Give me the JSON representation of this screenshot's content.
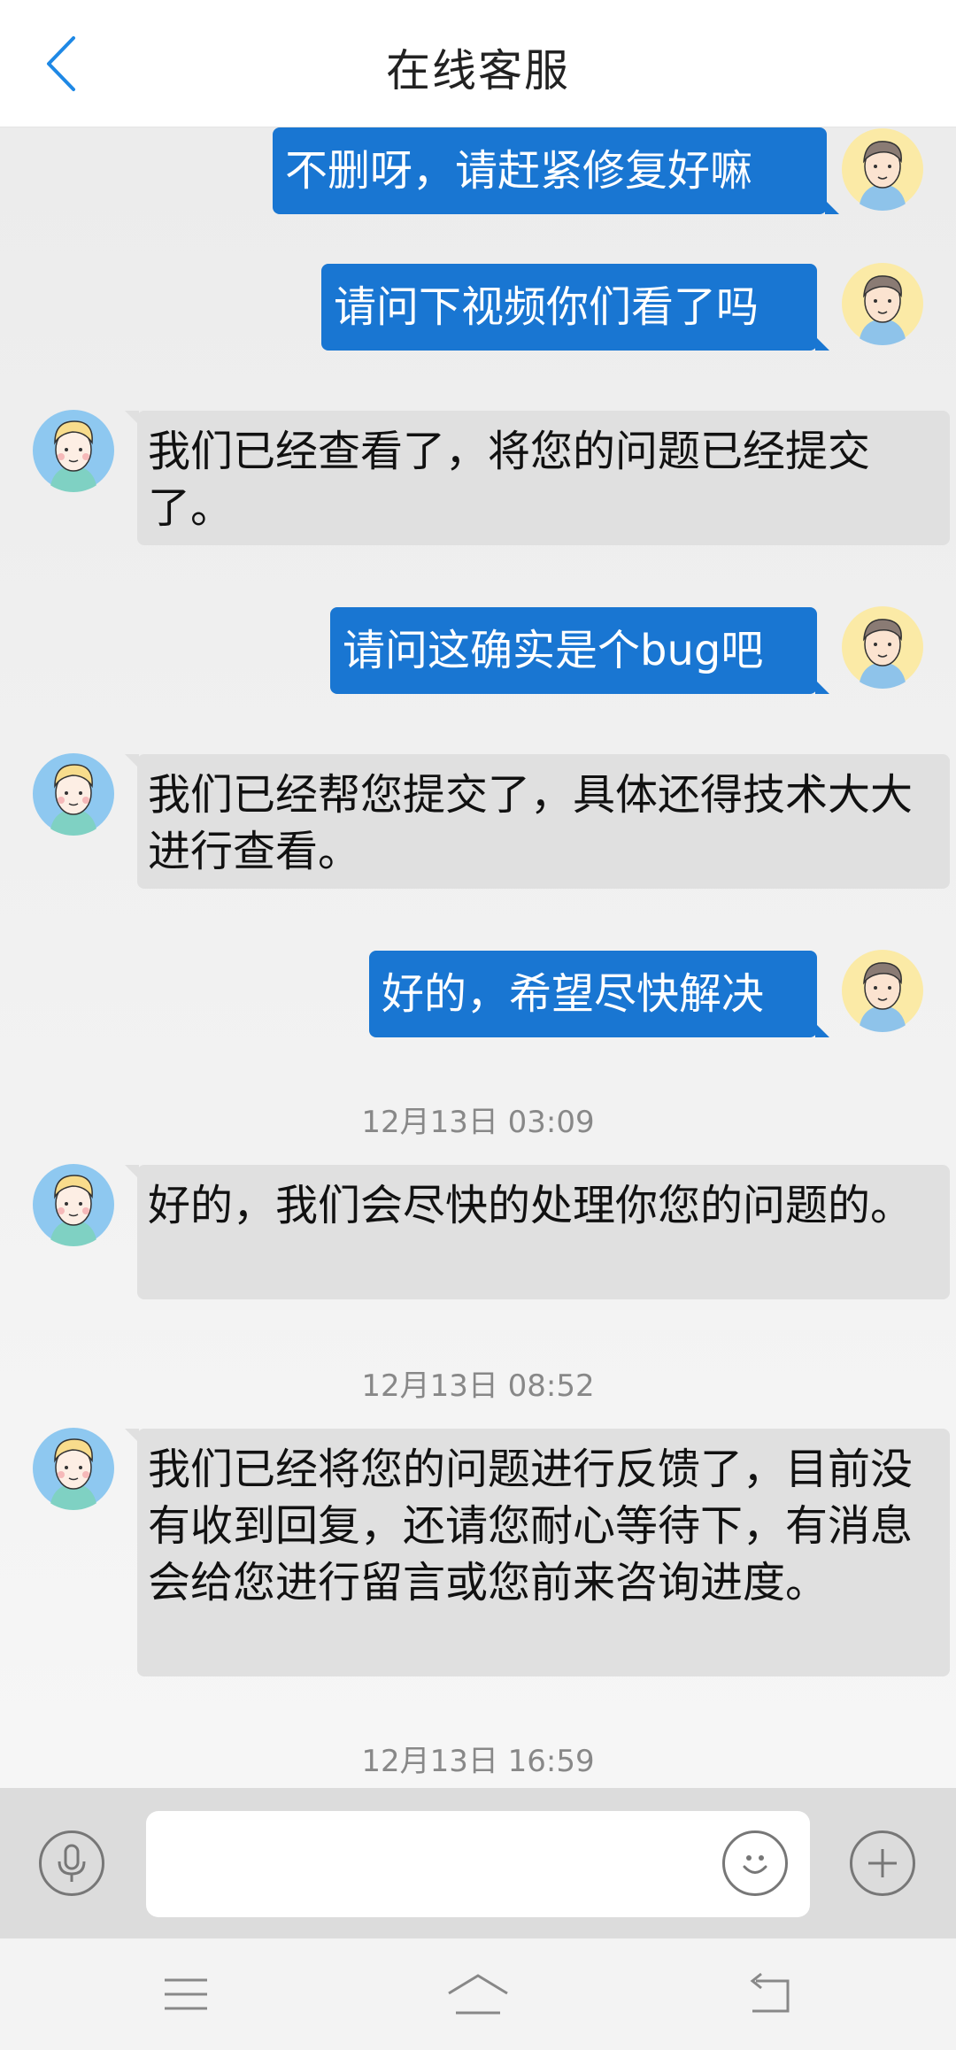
{
  "header": {
    "title": "在线客服"
  },
  "messages": [
    {
      "dir": "out",
      "text": "不删呀，请赶紧修复好嘛"
    },
    {
      "dir": "out",
      "text": "请问下视频你们看了吗"
    },
    {
      "dir": "in",
      "text": "我们已经查看了，将您的问题已经提交了。"
    },
    {
      "dir": "out",
      "text": "请问这确实是个bug吧"
    },
    {
      "dir": "in",
      "text": "我们已经帮您提交了，具体还得技术大大进行查看。"
    },
    {
      "dir": "out",
      "text": "好的，希望尽快解决"
    },
    {
      "dir": "in",
      "text": "好的，我们会尽快的处理你您的问题的。"
    },
    {
      "dir": "in",
      "text": "我们已经将您的问题进行反馈了，目前没有收到回复，还请您耐心等待下，有消息会给您进行留言或您前来咨询进度。"
    }
  ],
  "timestamps": [
    "12月13日 03:09",
    "12月13日 08:52",
    "12月13日 16:59"
  ],
  "input": {
    "value": "",
    "placeholder": ""
  },
  "colors": {
    "outgoing_bubble": "#1976d2",
    "incoming_bubble": "#e0e0e0",
    "accent": "#1e88e5"
  },
  "icons": {
    "back": "chevron-left-icon",
    "voice": "microphone-icon",
    "emoji": "smiley-icon",
    "more": "plus-icon",
    "menu": "menu-icon",
    "home": "home-icon",
    "return": "return-icon"
  }
}
